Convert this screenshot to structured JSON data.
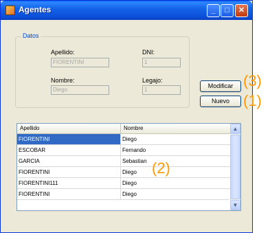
{
  "window": {
    "title": "Agentes"
  },
  "titlebar": {
    "minimize": "_",
    "maximize": "□",
    "close": "✕"
  },
  "datos": {
    "legend": "Datos",
    "apellido_label": "Apellido:",
    "apellido_value": "FIORENTINI",
    "dni_label": "DNI:",
    "dni_value": "1",
    "nombre_label": "Nombre:",
    "nombre_value": "Diego",
    "legajo_label": "Legajo:",
    "legajo_value": "1"
  },
  "buttons": {
    "modificar": "Modificar",
    "nuevo": "Nuevo"
  },
  "annotations": {
    "a3": "(3)",
    "a1": "(1)",
    "a2": "(2)"
  },
  "grid": {
    "columns": [
      "Apellido",
      "Nombre"
    ],
    "rows": [
      [
        "FIORENTINI",
        "Diego"
      ],
      [
        "ESCOBAR",
        "Fernando"
      ],
      [
        "GARCIA",
        "Sebastian"
      ],
      [
        "FIORENTINI",
        "Diego"
      ],
      [
        "FIORENTINI111",
        "Diego"
      ],
      [
        "FIORENTINI",
        "Diego"
      ]
    ],
    "selected_row": 0
  },
  "colors": {
    "titlebar": "#0b4ed8",
    "selection": "#316ac5",
    "annotation": "#ff9900",
    "window_bg": "#ece9d8"
  },
  "icons": {
    "app": "app-icon",
    "scroll_up": "chevron-up-icon",
    "scroll_down": "chevron-down-icon"
  }
}
